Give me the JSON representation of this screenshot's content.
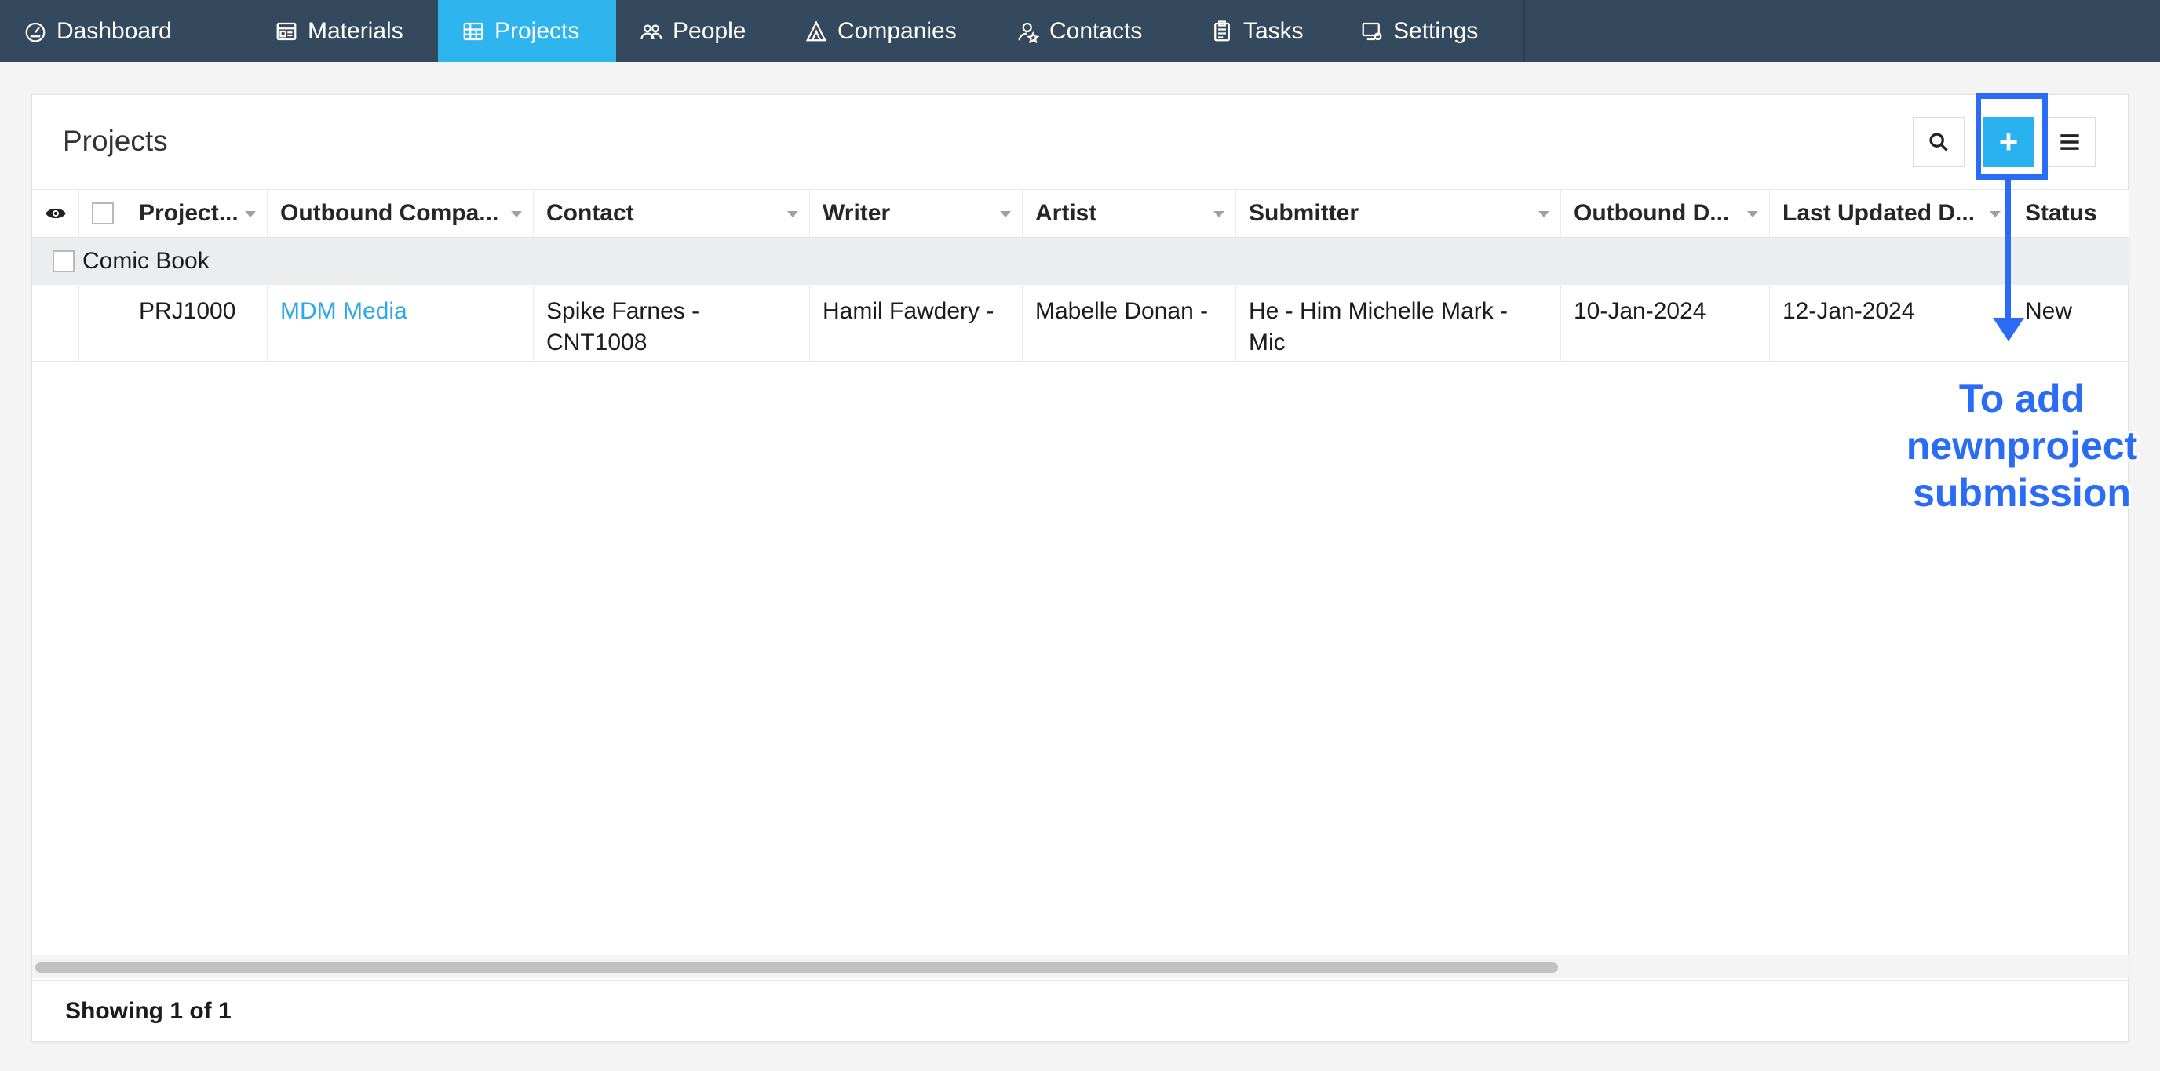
{
  "nav": {
    "items": [
      {
        "label": "Dashboard",
        "icon": "dashboard-gauge-icon"
      },
      {
        "label": "Materials",
        "icon": "materials-card-icon"
      },
      {
        "label": "Projects",
        "icon": "projects-grid-icon",
        "active": true
      },
      {
        "label": "People",
        "icon": "people-icon"
      },
      {
        "label": "Companies",
        "icon": "companies-icon"
      },
      {
        "label": "Contacts",
        "icon": "contacts-icon"
      },
      {
        "label": "Tasks",
        "icon": "tasks-clipboard-icon"
      },
      {
        "label": "Settings",
        "icon": "settings-icon"
      }
    ],
    "active_color": "#2fb5ee",
    "bar_color": "#34495e"
  },
  "panel": {
    "title": "Projects",
    "tools": {
      "search": "search-icon",
      "add": "+",
      "menu": "hamburger-menu-icon"
    }
  },
  "grid": {
    "columns": [
      "Project...",
      "Outbound Compa...",
      "Contact",
      "Writer",
      "Artist",
      "Submitter",
      "Outbound D...",
      "Last Updated D...",
      "Status"
    ],
    "group": {
      "label": "Comic Book"
    },
    "rows": [
      {
        "project": "PRJ1000",
        "outbound_company": "MDM Media",
        "contact": "Spike Farnes - CNT1008",
        "writer": "Hamil Fawdery -",
        "artist": "Mabelle Donan -",
        "submitter": "He - Him Michelle Mark - Mic",
        "outbound_date": "10-Jan-2024",
        "last_updated": "12-Jan-2024",
        "status": "New"
      }
    ]
  },
  "footer": {
    "showing": "Showing 1 of 1"
  },
  "annotation": {
    "text": "To add newnproject submission",
    "color": "#2a6df4"
  }
}
